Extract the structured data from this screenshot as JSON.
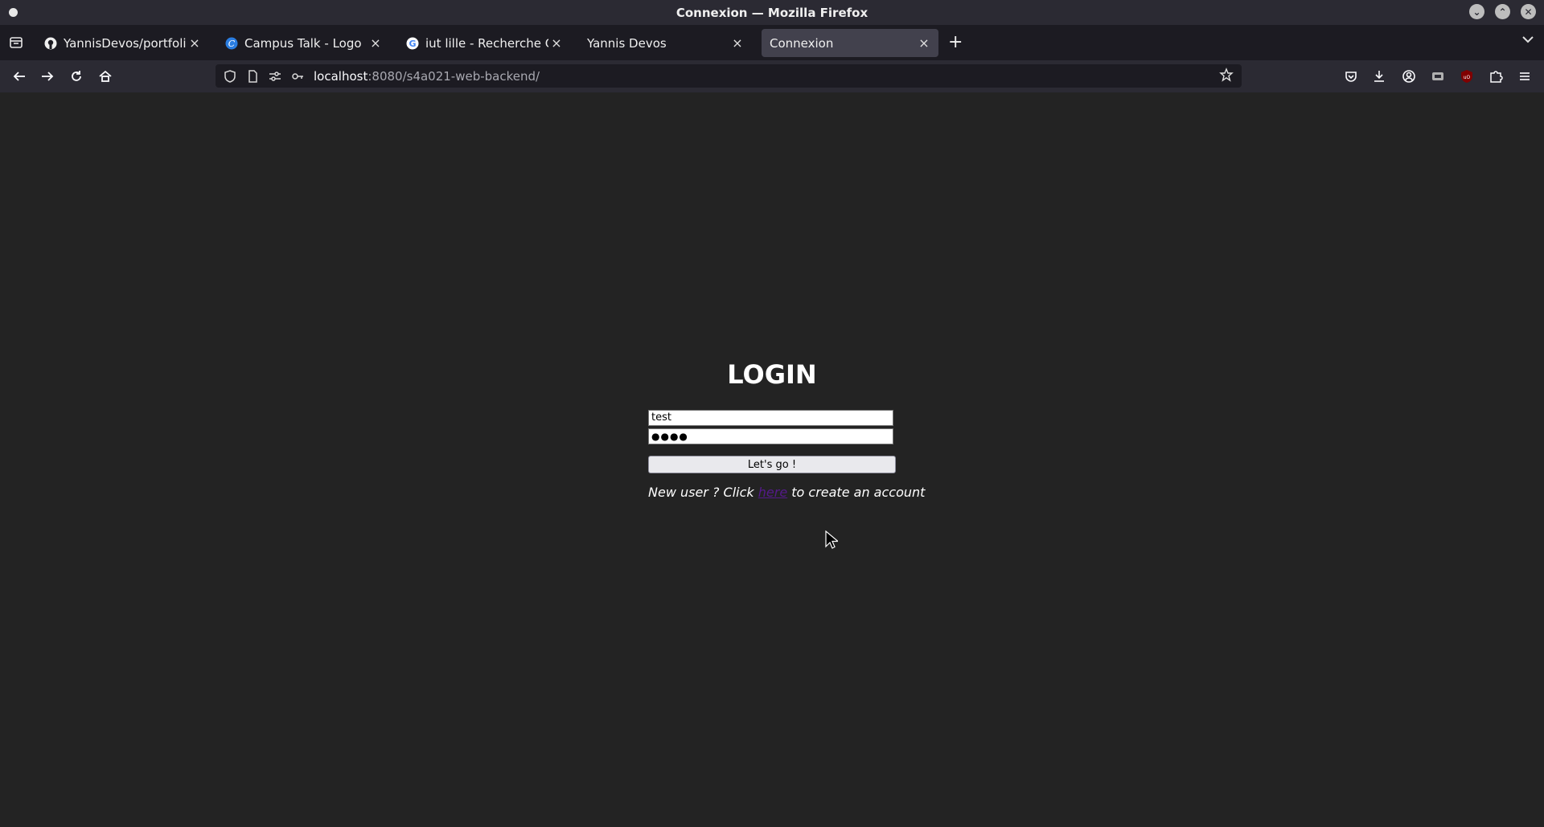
{
  "window": {
    "title": "Connexion — Mozilla Firefox"
  },
  "tabs": [
    {
      "label": "YannisDevos/portfolio: Th",
      "favicon": "github-icon",
      "active": false
    },
    {
      "label": "Campus Talk - Logo",
      "favicon": "canva-icon",
      "active": false
    },
    {
      "label": "iut lille - Recherche Googl",
      "favicon": "google-icon",
      "active": false
    },
    {
      "label": "Yannis Devos",
      "favicon": "none",
      "active": false
    },
    {
      "label": "Connexion",
      "favicon": "none",
      "active": true
    }
  ],
  "urlbar": {
    "host": "localhost",
    "rest": ":8080/s4a021-web-backend/"
  },
  "page": {
    "heading": "LOGIN",
    "username_value": "test",
    "password_value": "●●●●",
    "submit_label": "Let's go !",
    "signup_prefix": "New user ? Click ",
    "signup_link": "here",
    "signup_suffix": " to create an account"
  },
  "colors": {
    "background": "#232323",
    "link": "#551a8b",
    "tab_active": "#42414d"
  }
}
